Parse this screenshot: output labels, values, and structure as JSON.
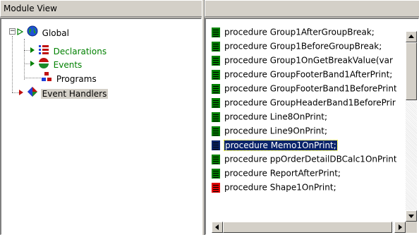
{
  "left_pane": {
    "header": "Module View",
    "tree": [
      {
        "label": "Global",
        "color": "#000000",
        "icon": "globe-icon"
      },
      {
        "label": "Declarations",
        "color": "#008000",
        "icon": "declarations-icon"
      },
      {
        "label": "Events",
        "color": "#008000",
        "icon": "events-icon"
      },
      {
        "label": "Programs",
        "color": "#000000",
        "icon": "programs-icon"
      },
      {
        "label": "Event Handlers",
        "color": "#000000",
        "icon": "event-handlers-icon",
        "selected": true
      }
    ]
  },
  "right_pane": {
    "header": "",
    "items": [
      {
        "text": "procedure Group1AfterGroupBreak;",
        "icon_color": "#008000"
      },
      {
        "text": "procedure Group1BeforeGroupBreak;",
        "icon_color": "#008000"
      },
      {
        "text": "procedure Group1OnGetBreakValue(var",
        "icon_color": "#008000"
      },
      {
        "text": "procedure GroupFooterBand1AfterPrint;",
        "icon_color": "#008000"
      },
      {
        "text": "procedure GroupFooterBand1BeforePrint",
        "icon_color": "#008000"
      },
      {
        "text": "procedure GroupHeaderBand1BeforePrir",
        "icon_color": "#008000"
      },
      {
        "text": "procedure Line8OnPrint;",
        "icon_color": "#008000"
      },
      {
        "text": "procedure Line9OnPrint;",
        "icon_color": "#008000"
      },
      {
        "text": "procedure Memo1OnPrint;",
        "icon_color": "#0a246a",
        "selected": true
      },
      {
        "text": "procedure ppOrderDetailDBCalc1OnPrint",
        "icon_color": "#008000"
      },
      {
        "text": "procedure ReportAfterPrint;",
        "icon_color": "#008000"
      },
      {
        "text": "procedure Shape1OnPrint;",
        "icon_color": "#e00000"
      }
    ]
  },
  "colors": {
    "highlight": "#0a246a",
    "tree_green": "#008000",
    "face": "#d4d0c8"
  }
}
